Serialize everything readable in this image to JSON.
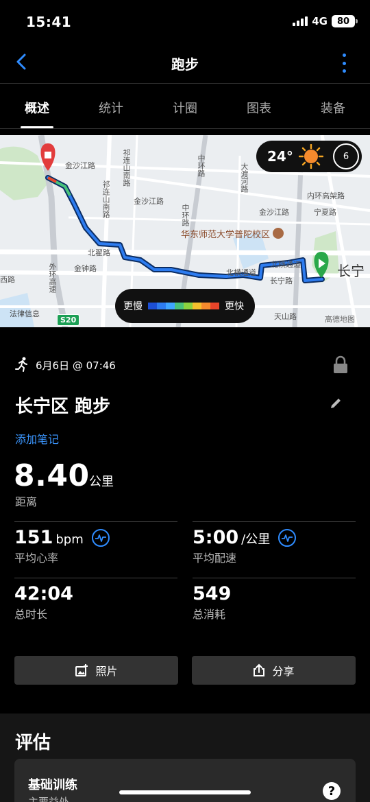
{
  "status": {
    "time": "15:41",
    "network": "4G",
    "battery": "80"
  },
  "nav": {
    "title": "跑步"
  },
  "tabs": [
    {
      "label": "概述",
      "active": true
    },
    {
      "label": "统计",
      "active": false
    },
    {
      "label": "计圈",
      "active": false
    },
    {
      "label": "图表",
      "active": false
    },
    {
      "label": "装备",
      "active": false
    }
  ],
  "map": {
    "labels": {
      "jinsha_jiang_road_1": "金沙江路",
      "jinsha_jiang_road_2": "金沙江路",
      "jinsha_jiang_road_3": "金沙江路",
      "qixin_road": "祁连山南路",
      "qixin_road_2": "祁连山南路",
      "zhonghuan": "中环路",
      "zhonghuan_2": "中环路",
      "dadu_river": "大渡河路",
      "university": "华东师范大学普陀校区",
      "beizhai_road": "北翟路",
      "beizhai_road_2": "北翟路",
      "jinzhong_road": "金钟路",
      "beiheng_road": "北横通道",
      "beiheng_road_2": "北横通道",
      "changning_road": "长宁路",
      "waihuan": "外环高速",
      "tianshan_road": "天山路",
      "ningxia_road": "宁夏路",
      "neihuan": "内环高架路",
      "changning_district": "长宁",
      "west_road": "西路",
      "legal": "法律信息",
      "amap": "高德地图",
      "s20": "S20"
    },
    "weather": {
      "temperature": "24°",
      "wind": "6"
    },
    "legend": {
      "slow": "更慢",
      "fast": "更快",
      "colors": [
        "#1c4fd6",
        "#2d7cf0",
        "#3fa6ff",
        "#49c27a",
        "#8bd23f",
        "#f5c02d",
        "#f58a2d",
        "#e8452a"
      ]
    }
  },
  "activity": {
    "date": "6月6日 @ 07:46",
    "title": "长宁区 跑步",
    "add_note": "添加笔记",
    "distance": {
      "value": "8.40",
      "unit": "公里",
      "label": "距离"
    },
    "stats": {
      "heart_rate": {
        "value": "151",
        "unit": "bpm",
        "label": "平均心率"
      },
      "pace": {
        "value": "5:00",
        "unit": "/公里",
        "label": "平均配速"
      },
      "duration": {
        "value": "42:04",
        "label": "总时长"
      },
      "calories": {
        "value": "549",
        "label": "总消耗"
      }
    },
    "buttons": {
      "photo": "照片",
      "share": "分享"
    }
  },
  "assessment": {
    "title": "评估",
    "card_title": "基础训练",
    "card_subtitle": "主要益处"
  }
}
